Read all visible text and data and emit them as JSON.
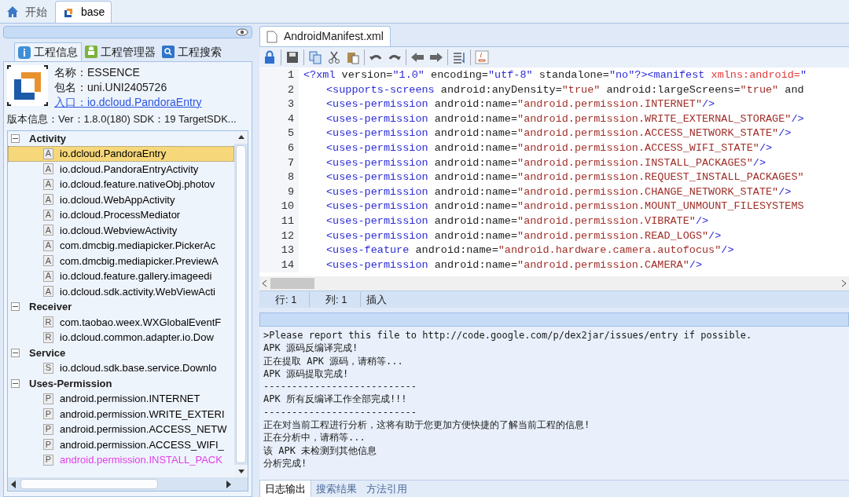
{
  "doc_tabs": [
    {
      "label": "开始",
      "selected": false
    },
    {
      "label": "base",
      "selected": true
    }
  ],
  "left_tabs": [
    {
      "label": "工程信息",
      "selected": true
    },
    {
      "label": "工程管理器",
      "selected": false
    },
    {
      "label": "工程搜索",
      "selected": false
    }
  ],
  "app_info": {
    "name": "名称：ESSENCE",
    "package": "包名：uni.UNI2405726",
    "entry": "入口：io.dcloud.PandoraEntry",
    "version": "版本信息：Ver：1.8.0(180) SDK：19 TargetSDK..."
  },
  "tree": [
    {
      "label": "Activity",
      "expanded": true,
      "children": [
        {
          "label": "io.dcloud.PandoraEntry",
          "letter": "A",
          "selected": true,
          "flagged": false
        },
        {
          "label": "io.dcloud.PandoraEntryActivity",
          "letter": "A",
          "selected": false,
          "flagged": false
        },
        {
          "label": "io.dcloud.feature.nativeObj.photov",
          "letter": "A",
          "selected": false,
          "flagged": false
        },
        {
          "label": "io.dcloud.WebAppActivity",
          "letter": "A",
          "selected": false,
          "flagged": false
        },
        {
          "label": "io.dcloud.ProcessMediator",
          "letter": "A",
          "selected": false,
          "flagged": false
        },
        {
          "label": "io.dcloud.WebviewActivity",
          "letter": "A",
          "selected": false,
          "flagged": false
        },
        {
          "label": "com.dmcbig.mediapicker.PickerAc",
          "letter": "A",
          "selected": false,
          "flagged": false
        },
        {
          "label": "com.dmcbig.mediapicker.PreviewA",
          "letter": "A",
          "selected": false,
          "flagged": false
        },
        {
          "label": "io.dcloud.feature.gallery.imageedi",
          "letter": "A",
          "selected": false,
          "flagged": false
        },
        {
          "label": "io.dcloud.sdk.activity.WebViewActi",
          "letter": "A",
          "selected": false,
          "flagged": false
        }
      ]
    },
    {
      "label": "Receiver",
      "expanded": true,
      "children": [
        {
          "label": "com.taobao.weex.WXGlobalEventF",
          "letter": "R",
          "selected": false,
          "flagged": false
        },
        {
          "label": "io.dcloud.common.adapter.io.Dow",
          "letter": "R",
          "selected": false,
          "flagged": false
        }
      ]
    },
    {
      "label": "Service",
      "expanded": true,
      "children": [
        {
          "label": "io.dcloud.sdk.base.service.Downlo",
          "letter": "S",
          "selected": false,
          "flagged": false
        }
      ]
    },
    {
      "label": "Uses-Permission",
      "expanded": true,
      "children": [
        {
          "label": "android.permission.INTERNET",
          "letter": "P",
          "selected": false,
          "flagged": false
        },
        {
          "label": "android.permission.WRITE_EXTERI",
          "letter": "P",
          "selected": false,
          "flagged": false
        },
        {
          "label": "android.permission.ACCESS_NETW",
          "letter": "P",
          "selected": false,
          "flagged": false
        },
        {
          "label": "android.permission.ACCESS_WIFI_",
          "letter": "P",
          "selected": false,
          "flagged": false
        },
        {
          "label": "android.permission.INSTALL_PACK",
          "letter": "P",
          "selected": false,
          "flagged": true
        }
      ]
    }
  ],
  "file_tab": {
    "label": "AndroidManifest.xml",
    "selected": true
  },
  "code_lines": [
    {
      "number": "1",
      "tokens": [
        {
          "kind": "tag",
          "text": "<?xml"
        },
        {
          "kind": "plain",
          "text": " version="
        },
        {
          "kind": "tag",
          "text": "\"1.0\""
        },
        {
          "kind": "plain",
          "text": " encoding="
        },
        {
          "kind": "tag",
          "text": "\"utf-8\""
        },
        {
          "kind": "plain",
          "text": " standalone="
        },
        {
          "kind": "tag",
          "text": "\"no\"?><manifest"
        },
        {
          "kind": "attr",
          "text": " xmlns:android="
        },
        {
          "kind": "tag",
          "text": "\""
        }
      ]
    },
    {
      "number": "2",
      "tokens": [
        {
          "kind": "tag",
          "text": "<supports-screens"
        },
        {
          "kind": "plain",
          "text": " android:anyDensity="
        },
        {
          "kind": "value",
          "text": "\"true\""
        },
        {
          "kind": "plain",
          "text": " android:largeScreens="
        },
        {
          "kind": "value",
          "text": "\"true\""
        },
        {
          "kind": "plain",
          "text": " and"
        }
      ]
    },
    {
      "number": "3",
      "tokens": [
        {
          "kind": "tag",
          "text": "<uses-permission"
        },
        {
          "kind": "plain",
          "text": " android:name="
        },
        {
          "kind": "value",
          "text": "\"android.permission.INTERNET\""
        },
        {
          "kind": "tag",
          "text": "/>"
        }
      ]
    },
    {
      "number": "4",
      "tokens": [
        {
          "kind": "tag",
          "text": "<uses-permission"
        },
        {
          "kind": "plain",
          "text": " android:name="
        },
        {
          "kind": "value",
          "text": "\"android.permission.WRITE_EXTERNAL_STORAGE\""
        },
        {
          "kind": "tag",
          "text": "/>"
        }
      ]
    },
    {
      "number": "5",
      "tokens": [
        {
          "kind": "tag",
          "text": "<uses-permission"
        },
        {
          "kind": "plain",
          "text": " android:name="
        },
        {
          "kind": "value",
          "text": "\"android.permission.ACCESS_NETWORK_STATE\""
        },
        {
          "kind": "tag",
          "text": "/>"
        }
      ]
    },
    {
      "number": "6",
      "tokens": [
        {
          "kind": "tag",
          "text": "<uses-permission"
        },
        {
          "kind": "plain",
          "text": " android:name="
        },
        {
          "kind": "value",
          "text": "\"android.permission.ACCESS_WIFI_STATE\""
        },
        {
          "kind": "tag",
          "text": "/>"
        }
      ]
    },
    {
      "number": "7",
      "tokens": [
        {
          "kind": "tag",
          "text": "<uses-permission"
        },
        {
          "kind": "plain",
          "text": " android:name="
        },
        {
          "kind": "value",
          "text": "\"android.permission.INSTALL_PACKAGES\""
        },
        {
          "kind": "tag",
          "text": "/>"
        }
      ]
    },
    {
      "number": "8",
      "tokens": [
        {
          "kind": "tag",
          "text": "<uses-permission"
        },
        {
          "kind": "plain",
          "text": " android:name="
        },
        {
          "kind": "value",
          "text": "\"android.permission.REQUEST_INSTALL_PACKAGES\""
        }
      ]
    },
    {
      "number": "9",
      "tokens": [
        {
          "kind": "tag",
          "text": "<uses-permission"
        },
        {
          "kind": "plain",
          "text": " android:name="
        },
        {
          "kind": "value",
          "text": "\"android.permission.CHANGE_NETWORK_STATE\""
        },
        {
          "kind": "tag",
          "text": "/>"
        }
      ]
    },
    {
      "number": "10",
      "tokens": [
        {
          "kind": "tag",
          "text": "<uses-permission"
        },
        {
          "kind": "plain",
          "text": " android:name="
        },
        {
          "kind": "value",
          "text": "\"android.permission.MOUNT_UNMOUNT_FILESYSTEMS"
        }
      ]
    },
    {
      "number": "11",
      "tokens": [
        {
          "kind": "tag",
          "text": "<uses-permission"
        },
        {
          "kind": "plain",
          "text": " android:name="
        },
        {
          "kind": "value",
          "text": "\"android.permission.VIBRATE\""
        },
        {
          "kind": "tag",
          "text": "/>"
        }
      ]
    },
    {
      "number": "12",
      "tokens": [
        {
          "kind": "tag",
          "text": "<uses-permission"
        },
        {
          "kind": "plain",
          "text": " android:name="
        },
        {
          "kind": "value",
          "text": "\"android.permission.READ_LOGS\""
        },
        {
          "kind": "tag",
          "text": "/>"
        }
      ]
    },
    {
      "number": "13",
      "tokens": [
        {
          "kind": "tag",
          "text": "<uses-feature"
        },
        {
          "kind": "plain",
          "text": " android:name="
        },
        {
          "kind": "value",
          "text": "\"android.hardware.camera.autofocus\""
        },
        {
          "kind": "tag",
          "text": "/>"
        }
      ]
    },
    {
      "number": "14",
      "tokens": [
        {
          "kind": "tag",
          "text": "<uses-permission"
        },
        {
          "kind": "plain",
          "text": " android:name="
        },
        {
          "kind": "value",
          "text": "\"android.permission.CAMERA\""
        },
        {
          "kind": "tag",
          "text": "/>"
        }
      ]
    }
  ],
  "status_bar": {
    "row": "行: 1",
    "column": "列: 1",
    "mode": "插入"
  },
  "log_lines": [
    ">Please report this file to http://code.google.com/p/dex2jar/issues/entry if possible.",
    "APK 源码反编译完成!",
    "正在提取 APK 源码，请稍等...",
    "APK 源码提取完成!",
    "---------------------------",
    "APK 所有反编译工作全部完成!!!",
    "---------------------------",
    "正在对当前工程进行分析，这将有助于您更加方便快捷的了解当前工程的信息!",
    "正在分析中，请稍等...",
    "该 APK 未检测到其他信息",
    "分析完成!"
  ],
  "bottom_tabs": [
    {
      "label": "日志输出",
      "selected": true
    },
    {
      "label": "搜索结果",
      "selected": false
    },
    {
      "label": "方法引用",
      "selected": false
    }
  ]
}
